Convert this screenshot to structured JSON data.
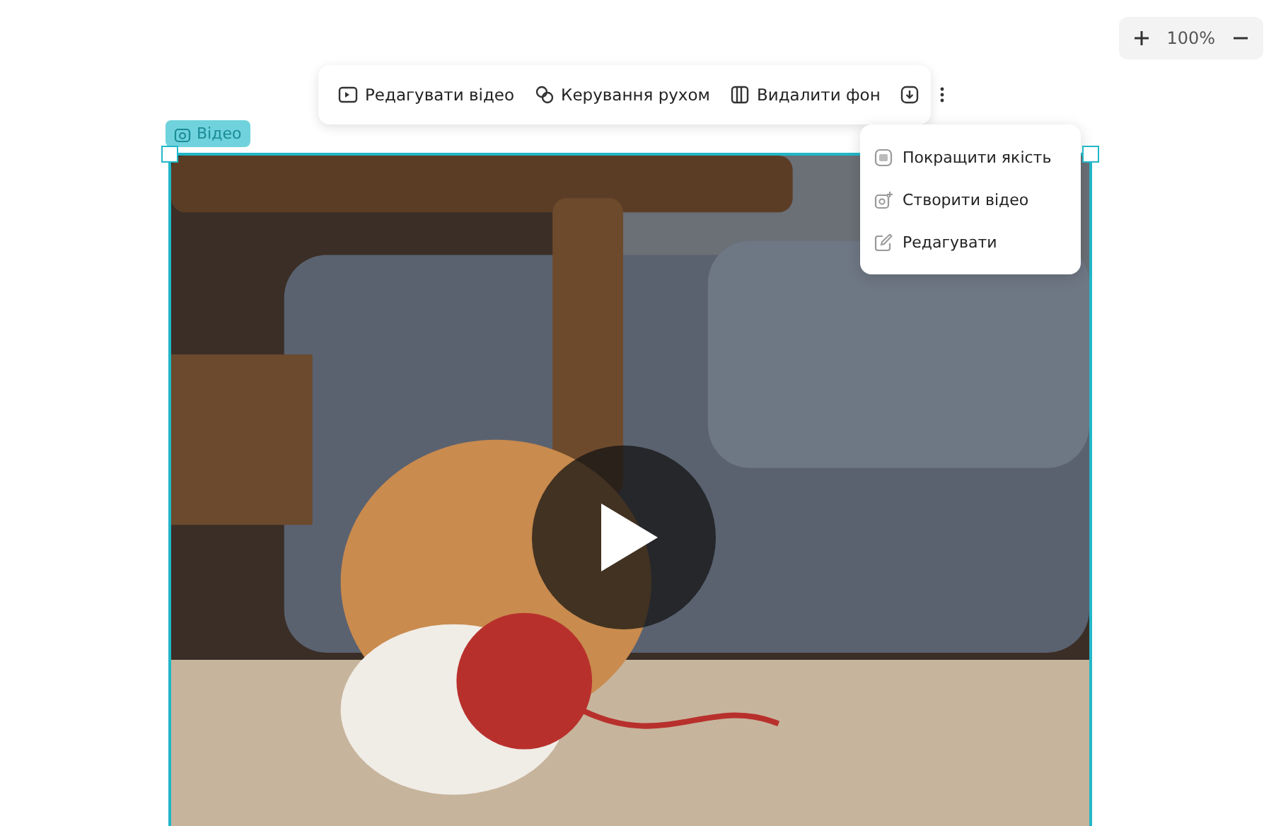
{
  "zoom": {
    "value": "100%"
  },
  "toolbar": {
    "items": [
      {
        "kind": "edit-video",
        "label": "Редагувати відео"
      },
      {
        "kind": "motion",
        "label": "Керування рухом"
      },
      {
        "kind": "remove-bg",
        "label": "Видалити фон"
      },
      {
        "kind": "download"
      },
      {
        "kind": "more"
      }
    ]
  },
  "badge": {
    "label": "Відео"
  },
  "menu": {
    "items": [
      {
        "kind": "hd",
        "label": "Покращити якість"
      },
      {
        "kind": "create",
        "label": "Створити відео"
      },
      {
        "kind": "edit",
        "label": "Редагувати"
      }
    ]
  }
}
